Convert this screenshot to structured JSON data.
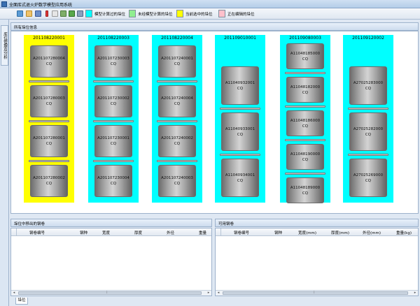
{
  "window": {
    "title": "全面库式退火炉数学模型应用系统"
  },
  "toolbar": {
    "icons": [
      "refresh-icon",
      "edit-icon",
      "save-icon",
      "alert-icon",
      "blank-icon",
      "export-icon",
      "play-icon",
      "print-icon"
    ],
    "legend": [
      {
        "label": "模型计算过的垛位",
        "color": "#00ffff"
      },
      {
        "label": "未经模型计算的垛位",
        "color": "#90ee90"
      },
      {
        "label": "当前选中的垛位",
        "color": "#ffff00"
      },
      {
        "label": "正在编辑的垛位",
        "color": "#ffc0cb"
      }
    ]
  },
  "sidebar": {
    "tab_label": "库位管理及分析"
  },
  "stock": {
    "header": "所有垛位信息",
    "slots": [
      {
        "id": "201108220001",
        "color": "#ffff00",
        "coils": [
          {
            "name": "A201107280004",
            "unit": "CQ"
          },
          {
            "name": "A201107280003",
            "unit": "CQ"
          },
          {
            "name": "A201107280001",
            "unit": "CQ"
          },
          {
            "name": "A201107280002",
            "unit": "CQ"
          }
        ]
      },
      {
        "id": "201108220003",
        "color": "#00ffff",
        "coils": [
          {
            "name": "A201107230003",
            "unit": "CQ"
          },
          {
            "name": "A201107230002",
            "unit": "CQ"
          },
          {
            "name": "A201107230001",
            "unit": "CQ"
          },
          {
            "name": "A201107230004",
            "unit": "CQ"
          }
        ]
      },
      {
        "id": "201108220004",
        "color": "#00ffff",
        "coils": [
          {
            "name": "A201107240001",
            "unit": "CQ"
          },
          {
            "name": "A201107240004",
            "unit": "CQ"
          },
          {
            "name": "A201107240002",
            "unit": "CQ"
          },
          {
            "name": "A201107240003",
            "unit": "CQ"
          }
        ]
      },
      {
        "id": "201109010001",
        "color": "#00ffff",
        "coils": [
          {
            "name": "A11040932001",
            "unit": "CQ"
          },
          {
            "name": "A11040933001",
            "unit": "CQ"
          },
          {
            "name": "A11040934001",
            "unit": "CQ"
          }
        ]
      },
      {
        "id": "201109080003",
        "color": "#00ffff",
        "coils": [
          {
            "name": "A11048185000",
            "unit": "CQ"
          },
          {
            "name": "A11048182000",
            "unit": "CQ"
          },
          {
            "name": "A11048186000",
            "unit": "CQ"
          },
          {
            "name": "A11048190000",
            "unit": "CQ"
          },
          {
            "name": "A11048189000",
            "unit": "CQ"
          }
        ]
      },
      {
        "id": "201109120002",
        "color": "#00ffff",
        "coils": [
          {
            "name": "A27025283000",
            "unit": "CQ"
          },
          {
            "name": "A27025282000",
            "unit": "CQ"
          },
          {
            "name": "A27025269000",
            "unit": "CQ"
          }
        ]
      }
    ]
  },
  "left_grid": {
    "header": "垛位中移出的钢卷",
    "columns": [
      "钢卷编号",
      "钢种",
      "宽度",
      "厚度",
      "外径",
      "重量"
    ]
  },
  "right_grid": {
    "header": "可用钢卷",
    "columns": [
      "钢卷编号",
      "钢种",
      "宽度(mm)",
      "厚度(mm)",
      "外径(mm)",
      "重量(kg)"
    ]
  },
  "bottom_tab": {
    "label": "垛位"
  }
}
